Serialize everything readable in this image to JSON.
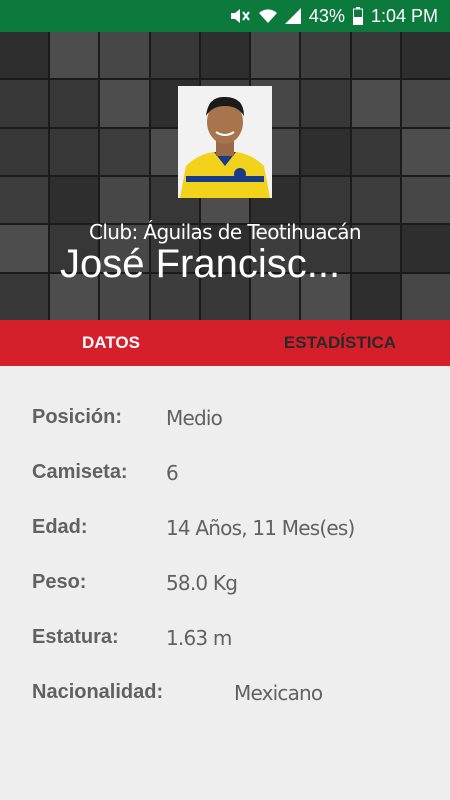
{
  "status_bar": {
    "battery": "43%",
    "time": "1:04 PM",
    "icons": [
      "mute-icon",
      "wifi-icon",
      "signal-icon",
      "battery-icon"
    ],
    "color": "#0d7a3d"
  },
  "header": {
    "club": "Club: Águilas de Teotihuacán",
    "player_name": "José Francisc..."
  },
  "tabs": {
    "datos": "DATOS",
    "estadistica": "ESTADÍSTICA",
    "active": "DATOS",
    "bar_color": "#d51f2b"
  },
  "details": {
    "rows": [
      {
        "label": "Posición:",
        "value": "Medio"
      },
      {
        "label": "Camiseta:",
        "value": "6"
      },
      {
        "label": "Edad:",
        "value": "14 Años, 11 Mes(es)"
      },
      {
        "label": "Peso:",
        "value": "58.0 Kg"
      },
      {
        "label": "Estatura:",
        "value": "1.63 m"
      },
      {
        "label": "Nacionalidad:",
        "value": "Mexicano"
      }
    ]
  }
}
